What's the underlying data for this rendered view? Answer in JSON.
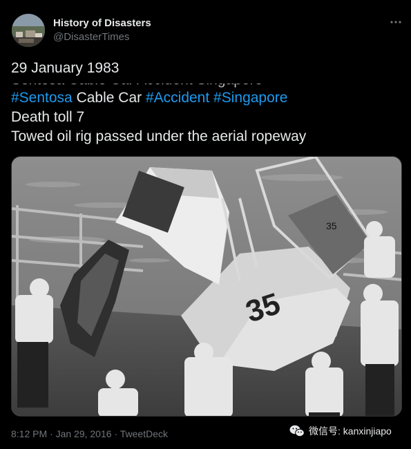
{
  "account": {
    "display_name": "History of Disasters",
    "handle": "@DisasterTimes"
  },
  "header": {
    "more_icon": "more-horizontal-icon"
  },
  "tweet": {
    "date_line": "29 January 1983",
    "partial_line": "Sentosa Cable Car Accident Singapore",
    "line1_parts": [
      "#Sentosa",
      " Cable Car ",
      "#Accident",
      " ",
      "#Singapore"
    ],
    "line2": "Death toll 7",
    "line3": "Towed oil rig passed under the aerial ropeway"
  },
  "photo": {
    "cabin_number": "35",
    "door_number": "35"
  },
  "footer": {
    "meta": "8:12 PM · Jan 29, 2016 · TweetDeck"
  },
  "watermark": {
    "text": "微信号: kanxinjiapo",
    "icon": "wechat-icon"
  },
  "colors": {
    "background": "#000000",
    "text": "#e7e9ea",
    "muted": "#71767b",
    "hashtag": "#1d9bf0"
  }
}
